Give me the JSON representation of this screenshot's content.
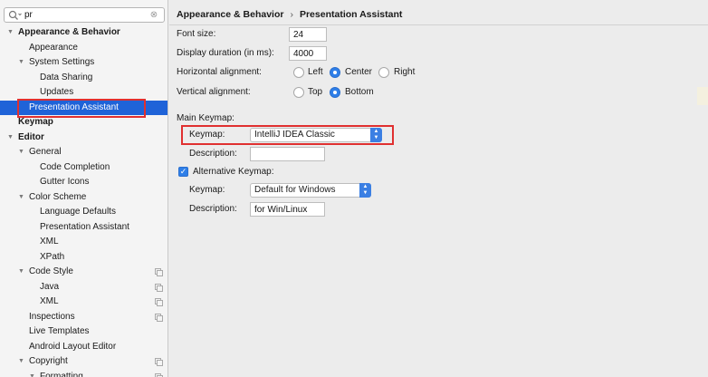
{
  "search": {
    "value": "pr",
    "clear_glyph": "⊗"
  },
  "tree": [
    {
      "label": "Appearance & Behavior",
      "level": 0,
      "expanded": true,
      "bold": true
    },
    {
      "label": "Appearance",
      "level": 1
    },
    {
      "label": "System Settings",
      "level": 1,
      "expanded": true
    },
    {
      "label": "Data Sharing",
      "level": 2
    },
    {
      "label": "Updates",
      "level": 2
    },
    {
      "label": "Presentation Assistant",
      "level": 1,
      "selected": true
    },
    {
      "label": "Keymap",
      "level": 0,
      "bold": true
    },
    {
      "label": "Editor",
      "level": 0,
      "expanded": true,
      "bold": true
    },
    {
      "label": "General",
      "level": 1,
      "expanded": true
    },
    {
      "label": "Code Completion",
      "level": 2
    },
    {
      "label": "Gutter Icons",
      "level": 2
    },
    {
      "label": "Color Scheme",
      "level": 1,
      "expanded": true
    },
    {
      "label": "Language Defaults",
      "level": 2
    },
    {
      "label": "Presentation Assistant",
      "level": 2
    },
    {
      "label": "XML",
      "level": 2
    },
    {
      "label": "XPath",
      "level": 2
    },
    {
      "label": "Code Style",
      "level": 1,
      "expanded": true,
      "project_icon": true
    },
    {
      "label": "Java",
      "level": 2,
      "project_icon": true
    },
    {
      "label": "XML",
      "level": 2,
      "project_icon": true
    },
    {
      "label": "Inspections",
      "level": 1,
      "project_icon": true
    },
    {
      "label": "Live Templates",
      "level": 1
    },
    {
      "label": "Android Layout Editor",
      "level": 1
    },
    {
      "label": "Copyright",
      "level": 1,
      "expanded": true,
      "project_icon": true
    },
    {
      "label": "Formatting",
      "level": 2,
      "expanded": true,
      "project_icon": true
    }
  ],
  "breadcrumb": {
    "parent": "Appearance & Behavior",
    "separator": "›",
    "current": "Presentation Assistant"
  },
  "form": {
    "font_size_label": "Font size:",
    "font_size_value": "24",
    "duration_label": "Display duration (in ms):",
    "duration_value": "4000",
    "h_align_label": "Horizontal alignment:",
    "h_align_options": [
      "Left",
      "Center",
      "Right"
    ],
    "h_align_selected": "Center",
    "v_align_label": "Vertical alignment:",
    "v_align_options": [
      "Top",
      "Bottom"
    ],
    "v_align_selected": "Bottom",
    "main_keymap_section": "Main Keymap:",
    "keymap_label": "Keymap:",
    "main_keymap_value": "IntelliJ IDEA Classic",
    "description_label": "Description:",
    "main_description_value": "",
    "alt_keymap_label": "Alternative Keymap:",
    "alt_keymap_checked": true,
    "alt_keymap_value": "Default for Windows",
    "alt_description_value": "for Win/Linux"
  },
  "colors": {
    "selection": "#1f63d8",
    "accent": "#2f7fe8",
    "highlight": "#e03030"
  },
  "icons": {
    "search": "search-icon",
    "expand_arrow": "chevron-down-icon",
    "combo": "up-down-arrows-icon",
    "checkbox": "check-icon",
    "project": "copy-icon"
  }
}
